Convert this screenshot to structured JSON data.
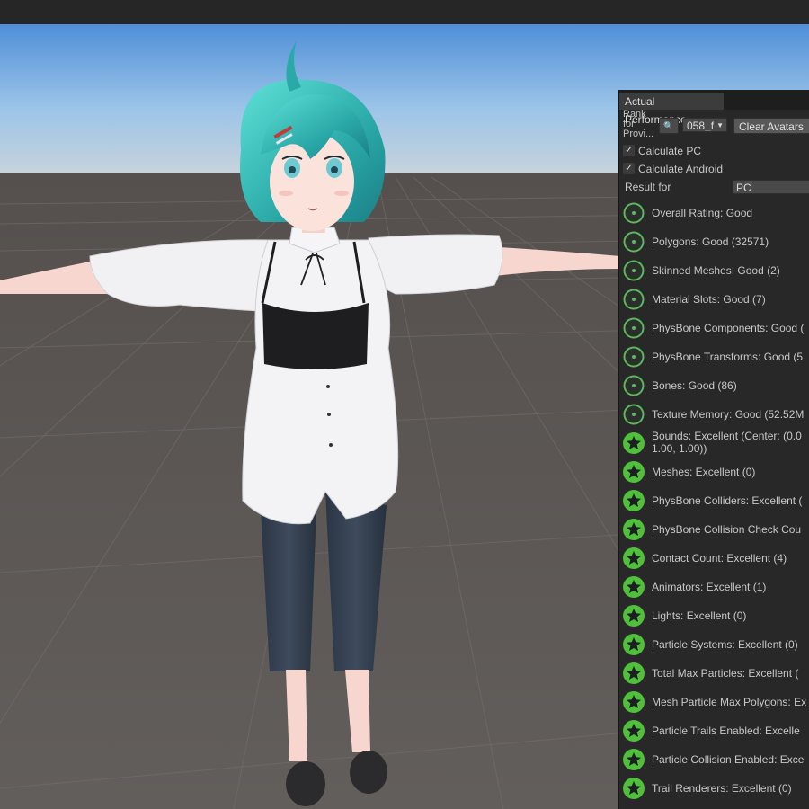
{
  "panel": {
    "tab_title": "Actual Performance",
    "rank_label": "Rank for Provi...",
    "avatar_select": "058_f",
    "clear_button": "Clear Avatars",
    "calculate_pc": "Calculate PC",
    "calculate_android": "Calculate Android",
    "result_for_label": "Result for",
    "result_for_value": "PC",
    "colors": {
      "good_icon": "#5cb85c",
      "excellent_icon": "#4fbf3c"
    },
    "stats": [
      {
        "text": "Overall Rating: Good",
        "rating": "good"
      },
      {
        "text": "Polygons: Good (32571)",
        "rating": "good"
      },
      {
        "text": "Skinned Meshes: Good (2)",
        "rating": "good"
      },
      {
        "text": "Material Slots: Good (7)",
        "rating": "good"
      },
      {
        "text": "PhysBone Components: Good (",
        "rating": "good"
      },
      {
        "text": "PhysBone Transforms: Good (5",
        "rating": "good"
      },
      {
        "text": "Bones: Good (86)",
        "rating": "good"
      },
      {
        "text": "Texture Memory: Good (52.52M",
        "rating": "good"
      },
      {
        "text": "Bounds: Excellent (Center: (0.0 1.00, 1.00))",
        "rating": "excellent"
      },
      {
        "text": "Meshes: Excellent (0)",
        "rating": "excellent"
      },
      {
        "text": "PhysBone Colliders: Excellent (",
        "rating": "excellent"
      },
      {
        "text": "PhysBone Collision Check Cou",
        "rating": "excellent"
      },
      {
        "text": "Contact Count: Excellent (4)",
        "rating": "excellent"
      },
      {
        "text": "Animators: Excellent (1)",
        "rating": "excellent"
      },
      {
        "text": "Lights: Excellent (0)",
        "rating": "excellent"
      },
      {
        "text": "Particle Systems: Excellent (0)",
        "rating": "excellent"
      },
      {
        "text": "Total Max Particles: Excellent (",
        "rating": "excellent"
      },
      {
        "text": "Mesh Particle Max Polygons: Ex",
        "rating": "excellent"
      },
      {
        "text": "Particle Trails Enabled: Excelle",
        "rating": "excellent"
      },
      {
        "text": "Particle Collision Enabled: Exce",
        "rating": "excellent"
      },
      {
        "text": "Trail Renderers: Excellent (0)",
        "rating": "excellent"
      }
    ]
  }
}
